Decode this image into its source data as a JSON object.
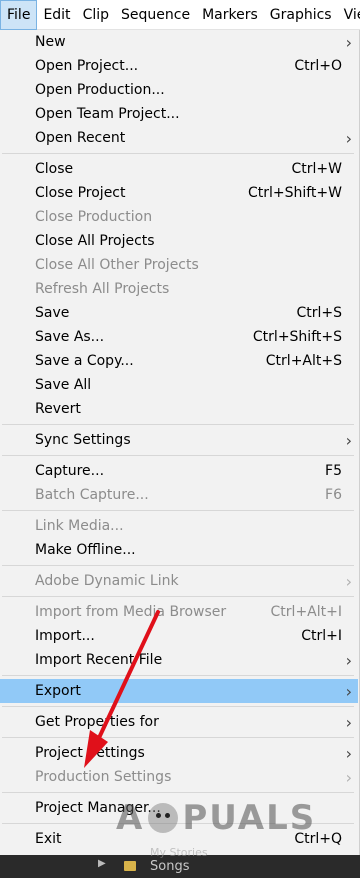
{
  "menubar": {
    "items": [
      {
        "label": "File"
      },
      {
        "label": "Edit"
      },
      {
        "label": "Clip"
      },
      {
        "label": "Sequence"
      },
      {
        "label": "Markers"
      },
      {
        "label": "Graphics"
      },
      {
        "label": "View"
      }
    ]
  },
  "file_menu": {
    "items": [
      {
        "label": "New",
        "shortcut": "",
        "submenu": true,
        "disabled": false
      },
      {
        "label": "Open Project...",
        "shortcut": "Ctrl+O"
      },
      {
        "label": "Open Production..."
      },
      {
        "label": "Open Team Project..."
      },
      {
        "label": "Open Recent",
        "submenu": true
      },
      {
        "label": "Close",
        "shortcut": "Ctrl+W"
      },
      {
        "label": "Close Project",
        "shortcut": "Ctrl+Shift+W"
      },
      {
        "label": "Close Production",
        "disabled": true
      },
      {
        "label": "Close All Projects"
      },
      {
        "label": "Close All Other Projects",
        "disabled": true
      },
      {
        "label": "Refresh All Projects",
        "disabled": true
      },
      {
        "label": "Save",
        "shortcut": "Ctrl+S"
      },
      {
        "label": "Save As...",
        "shortcut": "Ctrl+Shift+S"
      },
      {
        "label": "Save a Copy...",
        "shortcut": "Ctrl+Alt+S"
      },
      {
        "label": "Save All"
      },
      {
        "label": "Revert"
      },
      {
        "label": "Sync Settings",
        "submenu": true
      },
      {
        "label": "Capture...",
        "shortcut": "F5"
      },
      {
        "label": "Batch Capture...",
        "shortcut": "F6",
        "disabled": true
      },
      {
        "label": "Link Media...",
        "disabled": true
      },
      {
        "label": "Make Offline..."
      },
      {
        "label": "Adobe Dynamic Link",
        "submenu": true,
        "disabled": true
      },
      {
        "label": "Import from Media Browser",
        "shortcut": "Ctrl+Alt+I",
        "disabled": true
      },
      {
        "label": "Import...",
        "shortcut": "Ctrl+I"
      },
      {
        "label": "Import Recent File",
        "submenu": true
      },
      {
        "label": "Export",
        "submenu": true,
        "highlighted": true
      },
      {
        "label": "Get Properties for",
        "submenu": true
      },
      {
        "label": "Project Settings",
        "submenu": true
      },
      {
        "label": "Production Settings",
        "submenu": true,
        "disabled": true
      },
      {
        "label": "Project Manager..."
      },
      {
        "label": "Exit",
        "shortcut": "Ctrl+Q"
      }
    ]
  },
  "background": {
    "folder_label": "Songs",
    "ghost_label": "My Stories"
  },
  "watermark": {
    "text_left": "A",
    "text_right": "PUALS"
  },
  "colors": {
    "highlight": "#91c9f7",
    "active_menu": "#cde4f7",
    "annotation_arrow": "#e0101a"
  }
}
